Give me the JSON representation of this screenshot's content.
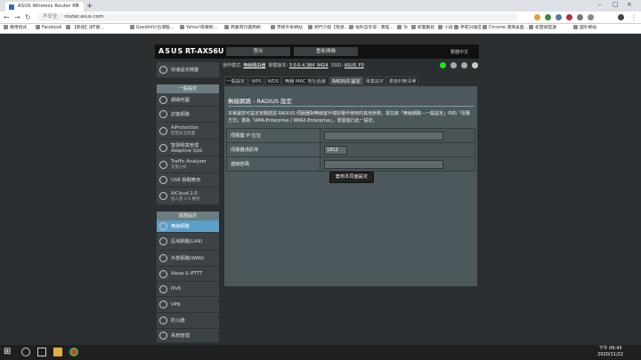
{
  "browser": {
    "tabs": [
      {
        "label": "ASUS Wireless Router RT-AX5...",
        "active": true
      }
    ],
    "url_security": "不安全",
    "url": "router.asus.com",
    "bookmarks": [
      "應用程式",
      "Facebook",
      "【熱搜】JKF捷...",
      "Goodinfo!台灣股...",
      "Yahoo!奇摩新...",
      "商業周刊電商網",
      "學術外掛網站",
      "熱門介紹【我感...",
      "福利自享得 - 壽理...",
      "3c",
      "新聞數創",
      "小說",
      "伊莉討論區",
      "Chrome 選擇桌面...",
      "松慧德提議",
      "國外網站"
    ]
  },
  "router": {
    "logo": "ASUS",
    "model": "RT-AX56U",
    "header_buttons": [
      "登出",
      "重新開機"
    ],
    "language": "繁體中文",
    "info": {
      "mode_label": "運作模式:",
      "mode_value": "無線路由器",
      "firmware_label": "韌體版本:",
      "firmware_value": "3.0.0.4.384_9424",
      "ssid_label": "SSID:",
      "ssid_value": "ASUS_F0"
    },
    "status_colors": [
      "#19e619",
      "#aaaaaa",
      "#aaaaaa",
      "#cccccc"
    ]
  },
  "sidebar": {
    "quick_setup": "快速設定精靈",
    "general_header": "一般設定",
    "general_items": [
      {
        "label": "網路地圖",
        "sub": ""
      },
      {
        "label": "訪客網路",
        "sub": ""
      },
      {
        "label": "AiProtection",
        "sub": "智慧安全防護"
      },
      {
        "label": "智慧頻寬管理 Adaptive QoS",
        "sub": ""
      },
      {
        "label": "Traffic Analyzer",
        "sub": "流量分析"
      },
      {
        "label": "USB 相關應用",
        "sub": ""
      },
      {
        "label": "AiCloud 2.0",
        "sub": "個人雲 2.0 應用"
      }
    ],
    "advanced_header": "進階設定",
    "advanced_items": [
      {
        "label": "無線網路",
        "active": true
      },
      {
        "label": "區域網路(LAN)",
        "active": false
      },
      {
        "label": "外部網路(WAN)",
        "active": false
      },
      {
        "label": "Alexa & IFTTT",
        "active": false
      },
      {
        "label": "IPv6",
        "active": false
      },
      {
        "label": "VPN",
        "active": false
      },
      {
        "label": "防火牆",
        "active": false
      },
      {
        "label": "系統管理",
        "active": false
      }
    ]
  },
  "subtabs": [
    {
      "label": "一般設定",
      "active": false
    },
    {
      "label": "WPS",
      "active": false
    },
    {
      "label": "WDS",
      "active": false
    },
    {
      "label": "無線 MAC 地址過濾器",
      "active": false
    },
    {
      "label": "RADIUS 設定",
      "active": true
    },
    {
      "label": "專業設定",
      "active": false
    },
    {
      "label": "漫遊封鎖清單",
      "active": false
    }
  ],
  "panel": {
    "title": "無線網路 - RADIUS 設定",
    "description": "本單讓您可設定有關建認 RADIUS 伺服器對無線客戶端授權作使用的其他參數。需在將「無線網路－一般設定」中的「授權方式」選為「WPA-Enterprise / WPA2-Enterprise」，便需進行此一設定。",
    "fields": [
      {
        "label": "伺服器 IP 位址",
        "value": ""
      },
      {
        "label": "伺服器通訊埠",
        "value": "1812"
      },
      {
        "label": "連線密碼",
        "value": ""
      }
    ],
    "apply_button": "套用本頁面設定"
  },
  "taskbar": {
    "time": "下午 06:43",
    "date": "2020/11/22"
  }
}
